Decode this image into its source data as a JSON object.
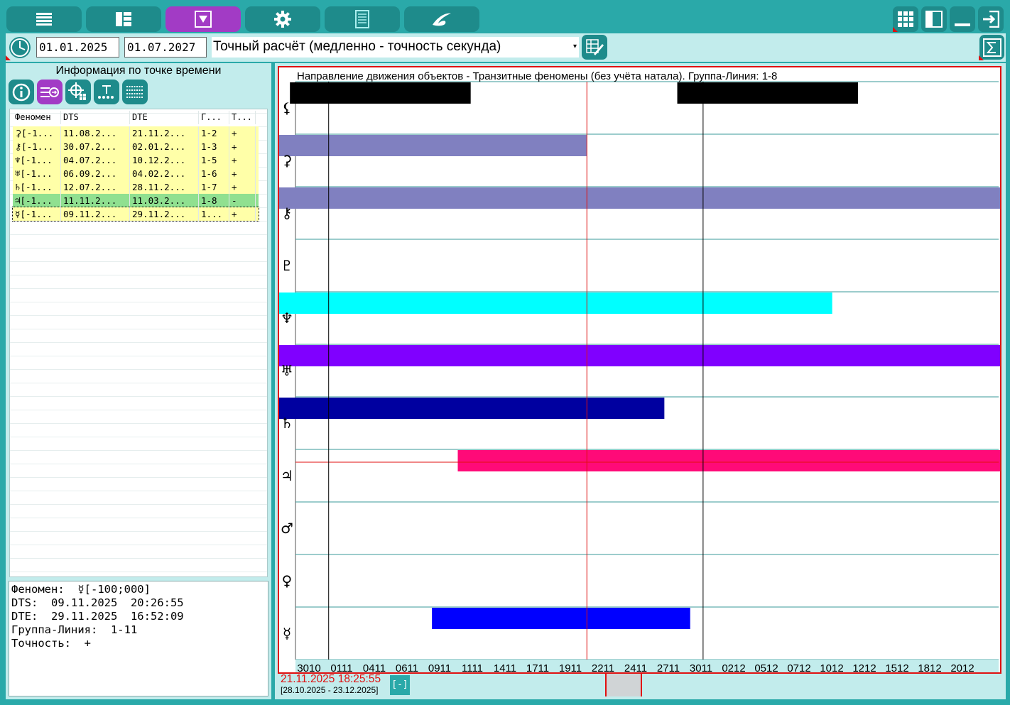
{
  "toolbar": {
    "buttons": [
      {
        "name": "list-menu-icon",
        "active": false
      },
      {
        "name": "dashboard-icon",
        "active": false
      },
      {
        "name": "dropdown-triangle-icon",
        "active": true
      },
      {
        "name": "gear-icon",
        "active": false
      },
      {
        "name": "document-icon",
        "active": false
      },
      {
        "name": "swirl-logo-icon",
        "active": false
      }
    ],
    "right_buttons": [
      "grid-icon",
      "panel-icon",
      "minimize-icon",
      "exit-icon"
    ]
  },
  "time_row": {
    "date_from": "01.01.2025",
    "date_to": "01.07.2027",
    "mode": "Точный расчёт (медленно - точность секунда)"
  },
  "left_panel": {
    "title": "Информация по точке времени",
    "table": {
      "headers": [
        "Феномен",
        "DTS",
        "DTE",
        "Г...",
        "Т..."
      ],
      "rows": [
        {
          "phenomenon": "⚳[-1...",
          "dts": "11.08.2...",
          "dte": "21.11.2...",
          "group": "1-2",
          "accuracy": "+",
          "color": "#ffffa8"
        },
        {
          "phenomenon": "⚷[-1...",
          "dts": "30.07.2...",
          "dte": "02.01.2...",
          "group": "1-3",
          "accuracy": "+",
          "color": "#ffffa8"
        },
        {
          "phenomenon": "♆[-1...",
          "dts": "04.07.2...",
          "dte": "10.12.2...",
          "group": "1-5",
          "accuracy": "+",
          "color": "#ffffa8"
        },
        {
          "phenomenon": "♅[-1...",
          "dts": "06.09.2...",
          "dte": "04.02.2...",
          "group": "1-6",
          "accuracy": "+",
          "color": "#ffffa8"
        },
        {
          "phenomenon": "♄[-1...",
          "dts": "12.07.2...",
          "dte": "28.11.2...",
          "group": "1-7",
          "accuracy": "+",
          "color": "#ffffa8"
        },
        {
          "phenomenon": "♃[-1...",
          "dts": "11.11.2...",
          "dte": "11.03.2...",
          "group": "1-8",
          "accuracy": "-",
          "color": "#90e090"
        },
        {
          "phenomenon": "☿[-1...",
          "dts": "09.11.2...",
          "dte": "29.11.2...",
          "group": "1...",
          "accuracy": "+",
          "color": "#ffffa8"
        }
      ]
    },
    "details": {
      "line1": "Феномен:  ☿[-100;000]",
      "line2": "DTS:  09.11.2025  20:26:55",
      "line3": "DTE:  29.11.2025  16:52:09",
      "line4": "Группа-Линия:  1-11",
      "line5": "Точность:  +"
    }
  },
  "chart": {
    "title": "Направление движения объектов - Транзитные феномены (без учёта натала). Группа-Линия: 1-8",
    "cursor_time": "21.11.2025 18:25:55",
    "range": "[28.10.2025 - 23.12.2025]",
    "zoom_button": "[-]"
  },
  "chart_data": {
    "type": "gantt",
    "x_range": [
      "2025-10-28",
      "2025-12-23"
    ],
    "x_ticks": [
      "3010",
      "0111",
      "0411",
      "0611",
      "0911",
      "1111",
      "1411",
      "1711",
      "1911",
      "2211",
      "2411",
      "2711",
      "3011",
      "0212",
      "0512",
      "0712",
      "1012",
      "1212",
      "1512",
      "1812",
      "2012"
    ],
    "cursor": "2025-11-21",
    "rows": [
      {
        "symbol": "⚸",
        "color": "#000000",
        "spans": [
          [
            "2025-10-29",
            "2025-11-12"
          ],
          [
            "2025-11-28",
            "2025-12-12"
          ]
        ]
      },
      {
        "symbol": "⚳",
        "color": "#8080c0",
        "spans": [
          [
            "2025-10-28",
            "2025-11-21"
          ]
        ]
      },
      {
        "symbol": "⚷",
        "color": "#8080c0",
        "spans": [
          [
            "2025-10-28",
            "2025-12-23"
          ]
        ]
      },
      {
        "symbol": "♇",
        "color": "#00ffff",
        "spans": []
      },
      {
        "symbol": "♆",
        "color": "#00ffff",
        "spans": [
          [
            "2025-10-28",
            "2025-12-10"
          ]
        ]
      },
      {
        "symbol": "♅",
        "color": "#8000ff",
        "spans": [
          [
            "2025-10-28",
            "2025-12-23"
          ]
        ]
      },
      {
        "symbol": "♄",
        "color": "#0000a0",
        "spans": [
          [
            "2025-10-28",
            "2025-11-27"
          ]
        ]
      },
      {
        "symbol": "♃",
        "color": "#ff0a78",
        "spans": [
          [
            "2025-11-11",
            "2025-12-23"
          ]
        ]
      },
      {
        "symbol": "♂",
        "color": "#000000",
        "spans": []
      },
      {
        "symbol": "♀",
        "color": "#000000",
        "spans": []
      },
      {
        "symbol": "☿",
        "color": "#0000ff",
        "spans": [
          [
            "2025-11-09",
            "2025-11-29"
          ]
        ]
      }
    ],
    "markers": [
      "2025-11-01",
      "2025-11-30"
    ]
  },
  "colors": {
    "toolbar": "#2aa9a9",
    "button": "#1e8b8b",
    "active_button": "#a23bc5",
    "panel": "#c2ecec",
    "cursor_red": "#e01010"
  }
}
